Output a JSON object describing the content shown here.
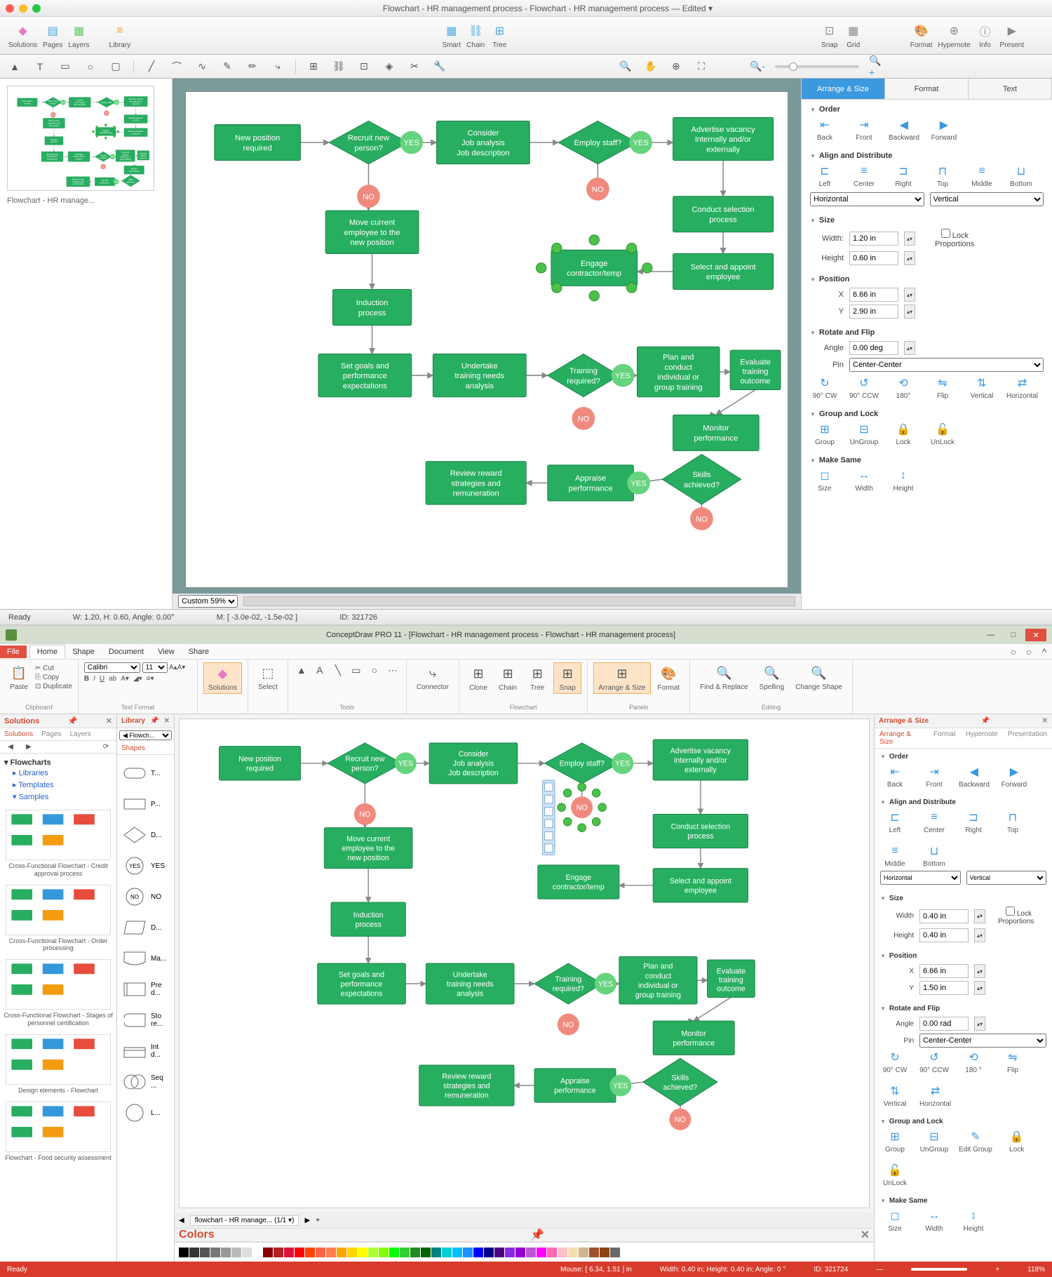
{
  "mac": {
    "title": "Flowchart - HR management process - Flowchart - HR management process — Edited ▾",
    "toolbar": [
      {
        "label": "Solutions",
        "icon": "◆",
        "color": "#e879c3"
      },
      {
        "label": "Pages",
        "icon": "▤",
        "color": "#4aa8e0"
      },
      {
        "label": "Layers",
        "icon": "▦",
        "color": "#5ec95e"
      }
    ],
    "toolbar2": [
      {
        "label": "Library",
        "icon": "≡",
        "color": "#f0a030"
      }
    ],
    "toolbar3": [
      {
        "label": "Smart",
        "icon": "▦",
        "color": "#4aa8e0"
      },
      {
        "label": "Chain",
        "icon": "⛓",
        "color": "#4aa8e0"
      },
      {
        "label": "Tree",
        "icon": "⊞",
        "color": "#4aa8e0"
      }
    ],
    "toolbar4": [
      {
        "label": "Snap",
        "icon": "⊡",
        "color": "#888"
      },
      {
        "label": "Grid",
        "icon": "▦",
        "color": "#888"
      }
    ],
    "toolbar5": [
      {
        "label": "Format",
        "icon": "🎨",
        "color": "#e879c3"
      },
      {
        "label": "Hypernote",
        "icon": "⊕",
        "color": "#888"
      },
      {
        "label": "Info",
        "icon": "ⓘ",
        "color": "#888"
      },
      {
        "label": "Present",
        "icon": "▶",
        "color": "#888"
      }
    ],
    "thumb_label": "Flowchart - HR manage...",
    "zoom_options": [
      "Custom 59%"
    ],
    "status": {
      "ready": "Ready",
      "wh": "W: 1.20,  H: 0.60,  Angle: 0.00°",
      "m": "M: [ -3.0e-02, -1.5e-02 ]",
      "id": "ID: 321726"
    },
    "right": {
      "tabs": [
        "Arrange & Size",
        "Format",
        "Text"
      ],
      "order": {
        "title": "Order",
        "items": [
          "Back",
          "Front",
          "Backward",
          "Forward"
        ]
      },
      "align": {
        "title": "Align and Distribute",
        "items": [
          "Left",
          "Center",
          "Right",
          "Top",
          "Middle",
          "Bottom"
        ],
        "horiz": "Horizontal",
        "vert": "Vertical"
      },
      "size": {
        "title": "Size",
        "width_label": "Width:",
        "width": "1.20 in",
        "height_label": "Height",
        "height": "0.60 in",
        "lock": "Lock Proportions"
      },
      "position": {
        "title": "Position",
        "x_label": "X",
        "x": "6.66 in",
        "y_label": "Y",
        "y": "2.90 in"
      },
      "rotate": {
        "title": "Rotate and Flip",
        "angle_label": "Angle",
        "angle": "0.00 deg",
        "pin_label": "Pin",
        "pin": "Center-Center",
        "items": [
          "90° CW",
          "90° CCW",
          "180°",
          "Flip",
          "Vertical",
          "Horizontal"
        ]
      },
      "group": {
        "title": "Group and Lock",
        "items": [
          "Group",
          "UnGroup",
          "Lock",
          "UnLock"
        ]
      },
      "same": {
        "title": "Make Same",
        "items": [
          "Size",
          "Width",
          "Height"
        ]
      }
    }
  },
  "flowchart": {
    "nodes": [
      {
        "id": "n1",
        "type": "box",
        "label": [
          "New position",
          "required"
        ]
      },
      {
        "id": "n2",
        "type": "diamond",
        "label": [
          "Recruit new",
          "person?"
        ]
      },
      {
        "id": "n3",
        "type": "box",
        "label": [
          "Consider",
          "Job analysis",
          "Job description"
        ]
      },
      {
        "id": "n4",
        "type": "diamond",
        "label": [
          "Employ staff?"
        ]
      },
      {
        "id": "n5",
        "type": "box",
        "label": [
          "Advertise vacancy",
          "internally and/or",
          "externally"
        ]
      },
      {
        "id": "n6",
        "type": "box",
        "label": [
          "Move current",
          "employee to the",
          "new position"
        ]
      },
      {
        "id": "n7",
        "type": "box",
        "label": [
          "Engage",
          "contractor/temp"
        ],
        "selected": true
      },
      {
        "id": "n8",
        "type": "box",
        "label": [
          "Conduct selection",
          "process"
        ]
      },
      {
        "id": "n9",
        "type": "box",
        "label": [
          "Select and appoint",
          "employee"
        ]
      },
      {
        "id": "n10",
        "type": "box",
        "label": [
          "Induction",
          "process"
        ]
      },
      {
        "id": "n11",
        "type": "box",
        "label": [
          "Set goals and",
          "performance",
          "expectations"
        ]
      },
      {
        "id": "n12",
        "type": "box",
        "label": [
          "Undertake",
          "training needs",
          "analysis"
        ]
      },
      {
        "id": "n13",
        "type": "diamond",
        "label": [
          "Training",
          "required?"
        ]
      },
      {
        "id": "n14",
        "type": "box",
        "label": [
          "Plan and",
          "conduct",
          "individual or",
          "group training"
        ]
      },
      {
        "id": "n15",
        "type": "box",
        "label": [
          "Evaluate training",
          "outcome"
        ]
      },
      {
        "id": "n16",
        "type": "box",
        "label": [
          "Monitor",
          "performance"
        ]
      },
      {
        "id": "n17",
        "type": "box",
        "label": [
          "Review reward",
          "strategies and",
          "remuneration"
        ]
      },
      {
        "id": "n18",
        "type": "box",
        "label": [
          "Appraise",
          "performance"
        ]
      },
      {
        "id": "n19",
        "type": "diamond",
        "label": [
          "Skills",
          "achieved?"
        ]
      }
    ],
    "yes": "YES",
    "no": "NO"
  },
  "win": {
    "title": "ConceptDraw PRO 11 - [Flowchart - HR management process - Flowchart - HR management process]",
    "menu": [
      "Home",
      "Shape",
      "Document",
      "View",
      "Share"
    ],
    "file": "File",
    "ribbon": {
      "clipboard": {
        "title": "Clipboard",
        "paste": "Paste",
        "cut": "Cut",
        "copy": "Copy",
        "dup": "Duplicate"
      },
      "textformat": {
        "title": "Text Format",
        "font": "Calibri",
        "size": "11"
      },
      "solutions": {
        "title": "",
        "btn": "Solutions"
      },
      "select": {
        "title": "",
        "btn": "Select"
      },
      "tools": {
        "title": "Tools"
      },
      "connector": {
        "title": "",
        "btn": "Connector"
      },
      "flowchart": {
        "title": "Flowchart",
        "items": [
          "Clone",
          "Chain",
          "Tree",
          "Snap"
        ]
      },
      "panels": {
        "title": "Panels",
        "items": [
          "Arrange & Size",
          "Format"
        ]
      },
      "editing": {
        "title": "Editing",
        "items": [
          "Find & Replace",
          "Spelling",
          "Change Shape"
        ]
      }
    },
    "solutions_panel": {
      "title": "Solutions",
      "tabs": [
        "Solutions",
        "Pages",
        "Layers"
      ],
      "tree_root": "Flowcharts",
      "tree": [
        "Libraries",
        "Templates",
        "Samples"
      ],
      "items": [
        "Cross-Functional Flowchart - Credit approval process",
        "Cross-Functional Flowchart - Order processing",
        "Cross-Functional Flowchart - Stages of personnel certification",
        "Design elements - Flowchart",
        "Flowchart - Food security assessment"
      ]
    },
    "library_panel": {
      "title": "Library",
      "dropdown": "Flowch...",
      "tab": "Shapes",
      "shapes": [
        "T...",
        "P...",
        "D...",
        "YES",
        "NO",
        "D...",
        "Ma...",
        "Pre d...",
        "Sto re...",
        "Int d...",
        "Seq ...",
        "L..."
      ]
    },
    "canvas_tab": "flowchart - HR manage...  (1/1 ▾)",
    "colors_title": "Colors",
    "right": {
      "title": "Arrange & Size",
      "tabs": [
        "Arrange & Size",
        "Format",
        "Hypernote",
        "Presentation"
      ],
      "order": {
        "title": "Order",
        "items": [
          "Back",
          "Front",
          "Backward",
          "Forward"
        ]
      },
      "align": {
        "title": "Align and Distribute",
        "items": [
          "Left",
          "Center",
          "Right",
          "Top",
          "Middle",
          "Bottom"
        ],
        "horiz": "Horizontal",
        "vert": "Vertical"
      },
      "size": {
        "title": "Size",
        "width_label": "Width",
        "width": "0.40 in",
        "height_label": "Height",
        "height": "0.40 in",
        "lock": "Lock Proportions"
      },
      "position": {
        "title": "Position",
        "x_label": "X",
        "x": "6.66 in",
        "y_label": "Y",
        "y": "1.50 in"
      },
      "rotate": {
        "title": "Rotate and Flip",
        "angle_label": "Angle",
        "angle": "0.00 rad",
        "pin_label": "Pin",
        "pin": "Center-Center",
        "items": [
          "90° CW",
          "90° CCW",
          "180 °",
          "Flip",
          "Vertical",
          "Horizontal"
        ]
      },
      "group": {
        "title": "Group and Lock",
        "items": [
          "Group",
          "UnGroup",
          "Edit Group",
          "Lock",
          "UnLock"
        ]
      },
      "same": {
        "title": "Make Same",
        "items": [
          "Size",
          "Width",
          "Height"
        ]
      }
    },
    "status": {
      "ready": "Ready",
      "mouse": "Mouse: [ 6.34, 1.51 ] in",
      "wh": "Width: 0.40 in;  Height: 0.40 in;  Angle: 0 °",
      "id": "ID: 321724",
      "zoom": "118%"
    }
  },
  "colors": [
    "#000",
    "#333",
    "#555",
    "#777",
    "#999",
    "#bbb",
    "#ddd",
    "#fff",
    "#8b0000",
    "#b22222",
    "#dc143c",
    "#ff0000",
    "#ff4500",
    "#ff6347",
    "#ff7f50",
    "#ffa500",
    "#ffd700",
    "#ffff00",
    "#adff2f",
    "#7fff00",
    "#00ff00",
    "#32cd32",
    "#228b22",
    "#006400",
    "#008080",
    "#00ced1",
    "#00bfff",
    "#1e90ff",
    "#0000ff",
    "#00008b",
    "#4b0082",
    "#8a2be2",
    "#9400d3",
    "#ba55d3",
    "#ff00ff",
    "#ff69b4",
    "#ffc0cb",
    "#f5deb3",
    "#d2b48c",
    "#a0522d",
    "#8b4513",
    "#696969"
  ]
}
